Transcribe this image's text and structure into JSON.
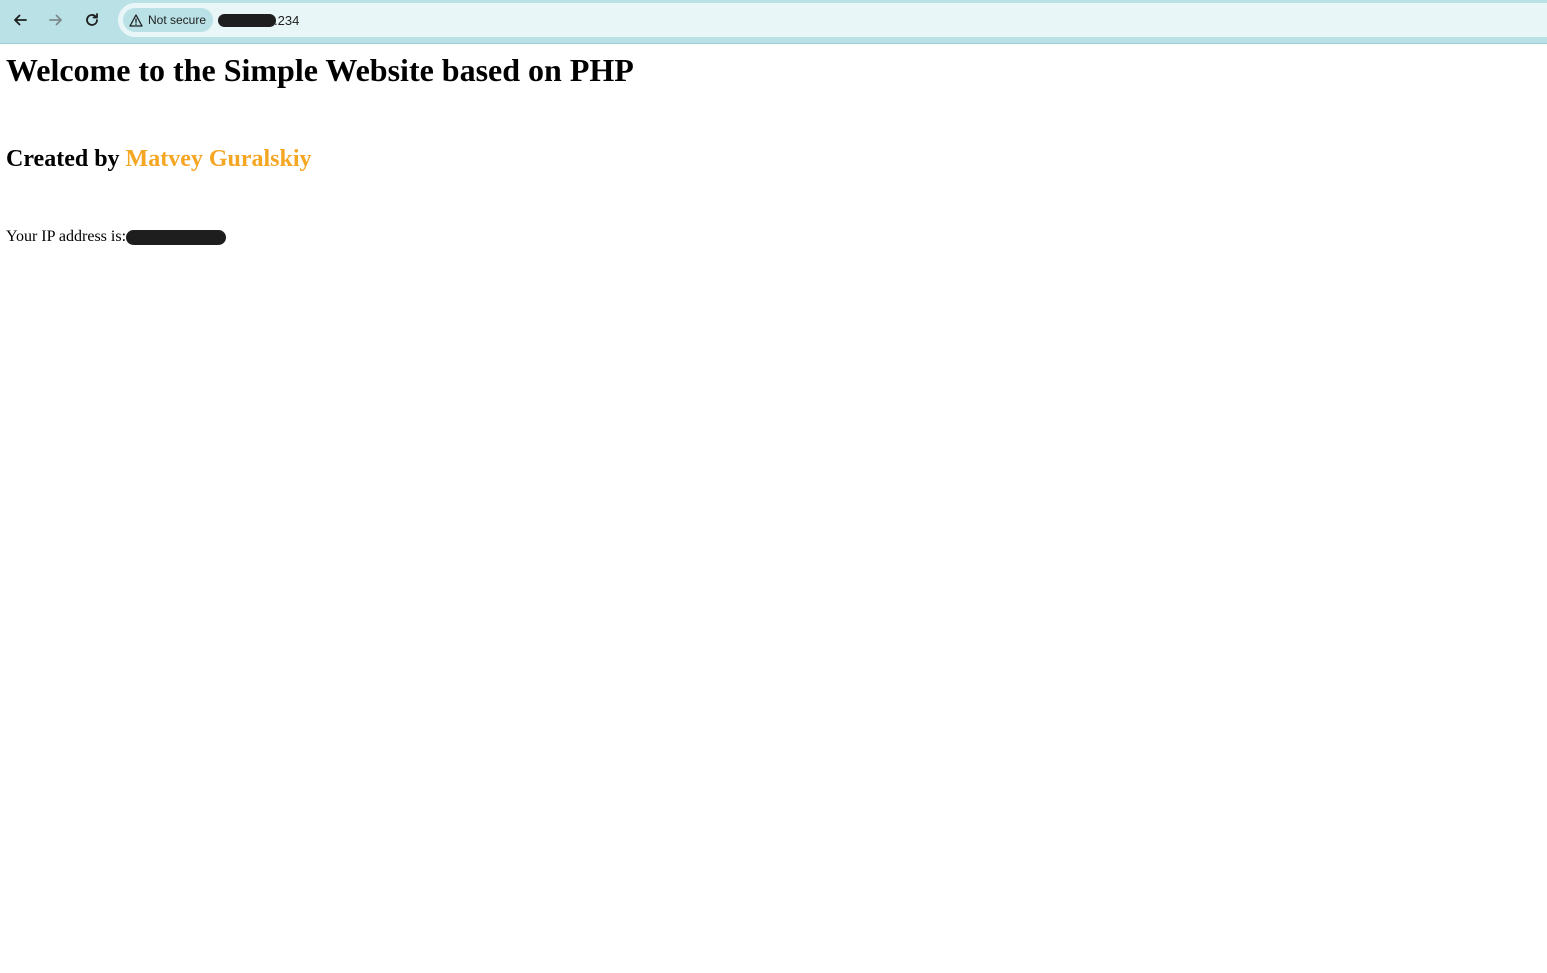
{
  "browser": {
    "security_label": "Not secure",
    "url_suffix": ".234",
    "icons": {
      "back": "arrow-left-icon",
      "forward": "arrow-right-icon",
      "reload": "reload-icon",
      "security": "warning-triangle-icon"
    }
  },
  "page": {
    "title": "Welcome to the Simple Website based on PHP",
    "created_prefix": "Created by ",
    "author": "Matvey Guralskiy",
    "author_color": "#f5a623",
    "ip_label": "Your IP address is:"
  }
}
